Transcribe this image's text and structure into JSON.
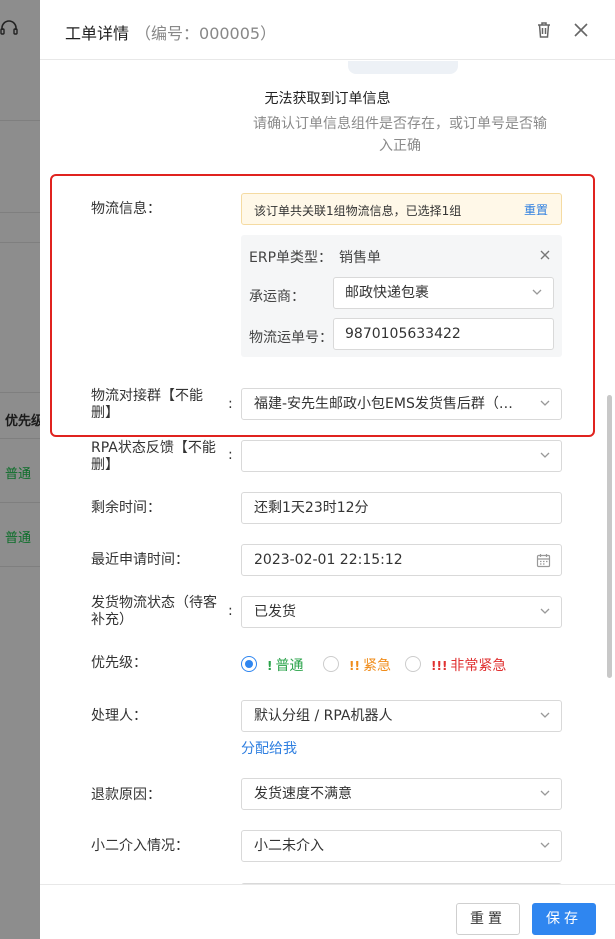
{
  "background": {
    "header_col": "优先级",
    "rows": [
      "普通",
      "普通"
    ]
  },
  "drawer": {
    "title": "工单详情",
    "code": "（编号：000005）",
    "empty": {
      "title": "无法获取到订单信息",
      "desc": "请确认订单信息组件是否存在，或订单号是否输入正确"
    },
    "logistics": {
      "label": "物流信息：",
      "alert": "该订单共关联1组物流信息，已选择1组",
      "reset": "重置",
      "erp_label": "ERP单类型：",
      "erp_value": "销售单",
      "carrier_label": "承运商：",
      "carrier_value": "邮政快递包裹",
      "tracking_label": "物流运单号：",
      "tracking_value": "9870105633422"
    },
    "group": {
      "label": "物流对接群【不能删】",
      "value": "福建-安先生邮政小包EMS发货售后群（福..."
    },
    "rpa": {
      "label": "RPA状态反馈【不能删】",
      "value": ""
    },
    "remaining": {
      "label": "剩余时间：",
      "value": "还剩1天23时12分"
    },
    "apply_time": {
      "label": "最近申请时间：",
      "value": "2023-02-01 22:15:12"
    },
    "ship_status": {
      "label": "发货物流状态（待客补充）",
      "value": "已发货"
    },
    "priority": {
      "label": "优先级：",
      "options": [
        {
          "mark": "!",
          "text": "普通",
          "color": "#2aa34a"
        },
        {
          "mark": "!!",
          "text": "紧急",
          "color": "#f08c1a"
        },
        {
          "mark": "!!!",
          "text": "非常紧急",
          "color": "#e03131"
        }
      ],
      "selected": "普通"
    },
    "handler": {
      "label": "处理人：",
      "value": "默认分组 / RPA机器人",
      "assign": "分配给我"
    },
    "refund": {
      "label": "退款原因：",
      "value": "发货速度不满意"
    },
    "intervene": {
      "label": "小二介入情况：",
      "value": "小二未介入"
    },
    "footer": {
      "reset": "重置",
      "save": "保存"
    }
  }
}
